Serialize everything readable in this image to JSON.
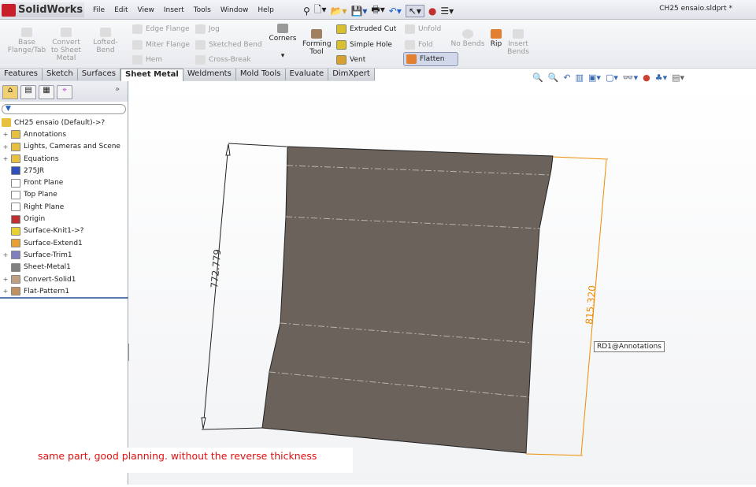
{
  "app": {
    "name": "SolidWorks",
    "logo_text": "SW",
    "document_title": "CH25 ensaio.sldprt *"
  },
  "menu": [
    "File",
    "Edit",
    "View",
    "Insert",
    "Tools",
    "Window",
    "Help"
  ],
  "ribbon": {
    "base_flange": "Base Flange/Tab",
    "convert": "Convert to Sheet Metal",
    "lofted": "Lofted-Bend",
    "edge_flange": "Edge Flange",
    "miter_flange": "Miter Flange",
    "hem": "Hem",
    "jog": "Jog",
    "sketched_bend": "Sketched Bend",
    "cross_break": "Cross-Break",
    "corners": "Corners",
    "forming_tool": "Forming Tool",
    "extruded_cut": "Extruded Cut",
    "simple_hole": "Simple Hole",
    "vent": "Vent",
    "unfold": "Unfold",
    "fold": "Fold",
    "flatten": "Flatten",
    "no_bends": "No Bends",
    "rip": "Rip",
    "insert_bends": "Insert Bends"
  },
  "tabs": [
    "Features",
    "Sketch",
    "Surfaces",
    "Sheet Metal",
    "Weldments",
    "Mold Tools",
    "Evaluate",
    "DimXpert"
  ],
  "active_tab": "Sheet Metal",
  "tree": {
    "root": "CH25 ensaio  (Default)->?",
    "items": [
      {
        "label": "Annotations",
        "expand": true,
        "color": "#e8c040"
      },
      {
        "label": "Lights, Cameras and Scene",
        "expand": true,
        "color": "#e8c040"
      },
      {
        "label": "Equations",
        "expand": true,
        "color": "#e8c040"
      },
      {
        "label": "275JR",
        "expand": false,
        "color": "#3050c0"
      },
      {
        "label": "Front Plane",
        "expand": false,
        "color": "#ffffff"
      },
      {
        "label": "Top Plane",
        "expand": false,
        "color": "#ffffff"
      },
      {
        "label": "Right Plane",
        "expand": false,
        "color": "#ffffff"
      },
      {
        "label": "Origin",
        "expand": false,
        "color": "#c03030"
      },
      {
        "label": "Surface-Knit1->?",
        "expand": false,
        "color": "#e8d030"
      },
      {
        "label": "Surface-Extend1",
        "expand": false,
        "color": "#e8a030"
      },
      {
        "label": "Surface-Trim1",
        "expand": true,
        "color": "#8080c0"
      },
      {
        "label": "Sheet-Metal1",
        "expand": false,
        "color": "#808080"
      },
      {
        "label": "Convert-Solid1",
        "expand": true,
        "color": "#c0a080"
      },
      {
        "label": "Flat-Pattern1",
        "expand": true,
        "color": "#c09060"
      }
    ]
  },
  "viewport": {
    "dim_left": "772.779",
    "dim_right": "815.320",
    "tooltip": "RD1@Annotations",
    "note": "same part, good planning. without the reverse thickness",
    "part_color": "#6b625c",
    "dim_right_color": "#f08c00",
    "note_color": "#e01010"
  }
}
